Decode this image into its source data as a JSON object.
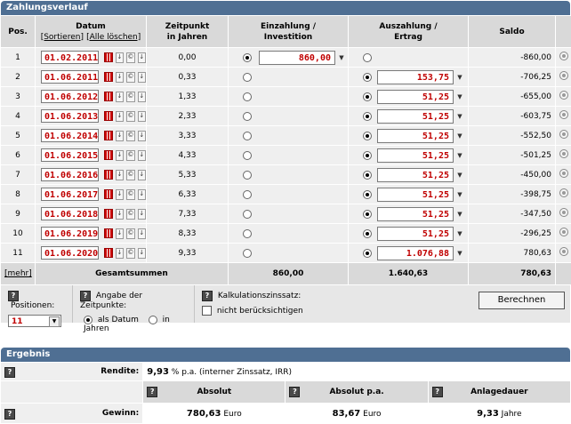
{
  "section1": {
    "title": "Zahlungsverlauf"
  },
  "table": {
    "headers": {
      "pos": "Pos.",
      "datum": "Datum",
      "sortieren": "[Sortieren]",
      "alle_loeschen": "[Alle löschen]",
      "zeitpunkt_1": "Zeitpunkt",
      "zeitpunkt_2": "in Jahren",
      "einzahlung_1": "Einzahlung /",
      "einzahlung_2": "Investition",
      "auszahlung_1": "Auszahlung /",
      "auszahlung_2": "Ertrag",
      "saldo": "Saldo"
    },
    "rows": [
      {
        "pos": "1",
        "date": "01.02.2011",
        "years": "0,00",
        "type": "in",
        "amount": "860,00",
        "saldo": "-860,00"
      },
      {
        "pos": "2",
        "date": "01.06.2011",
        "years": "0,33",
        "type": "out",
        "amount": "153,75",
        "saldo": "-706,25"
      },
      {
        "pos": "3",
        "date": "01.06.2012",
        "years": "1,33",
        "type": "out",
        "amount": "51,25",
        "saldo": "-655,00"
      },
      {
        "pos": "4",
        "date": "01.06.2013",
        "years": "2,33",
        "type": "out",
        "amount": "51,25",
        "saldo": "-603,75"
      },
      {
        "pos": "5",
        "date": "01.06.2014",
        "years": "3,33",
        "type": "out",
        "amount": "51,25",
        "saldo": "-552,50"
      },
      {
        "pos": "6",
        "date": "01.06.2015",
        "years": "4,33",
        "type": "out",
        "amount": "51,25",
        "saldo": "-501,25"
      },
      {
        "pos": "7",
        "date": "01.06.2016",
        "years": "5,33",
        "type": "out",
        "amount": "51,25",
        "saldo": "-450,00"
      },
      {
        "pos": "8",
        "date": "01.06.2017",
        "years": "6,33",
        "type": "out",
        "amount": "51,25",
        "saldo": "-398,75"
      },
      {
        "pos": "9",
        "date": "01.06.2018",
        "years": "7,33",
        "type": "out",
        "amount": "51,25",
        "saldo": "-347,50"
      },
      {
        "pos": "10",
        "date": "01.06.2019",
        "years": "8,33",
        "type": "out",
        "amount": "51,25",
        "saldo": "-296,25"
      },
      {
        "pos": "11",
        "date": "01.06.2020",
        "years": "9,33",
        "type": "out",
        "amount": "1.076,88",
        "saldo": "780,63"
      }
    ],
    "summary": {
      "mehr": "[mehr]",
      "label": "Gesamtsummen",
      "einzahlung": "860,00",
      "auszahlung": "1.640,63",
      "saldo": "780,63"
    }
  },
  "options": {
    "positionen_label": "Positionen:",
    "positionen_value": "11",
    "zeitpunkte_label": "Angabe der Zeitpunkte:",
    "als_datum": "als Datum",
    "in_jahren": "in Jahren",
    "zins_label": "Kalkulationszinssatz:",
    "nicht_label": "nicht berücksichtigen",
    "berechnen": "Berechnen"
  },
  "section2": {
    "title": "Ergebnis",
    "rendite_label": "Rendite:",
    "rendite_value": "9,93",
    "rendite_unit": "% p.a. (interner Zinssatz, IRR)",
    "col_absolut": "Absolut",
    "col_absolut_pa": "Absolut p.a.",
    "col_anlagedauer": "Anlagedauer",
    "gewinn_label": "Gewinn:",
    "absolut_value": "780,63",
    "absolut_unit": "Euro",
    "absolut_pa_value": "83,67",
    "absolut_pa_unit": "Euro",
    "dauer_value": "9,33",
    "dauer_unit": "Jahre"
  }
}
